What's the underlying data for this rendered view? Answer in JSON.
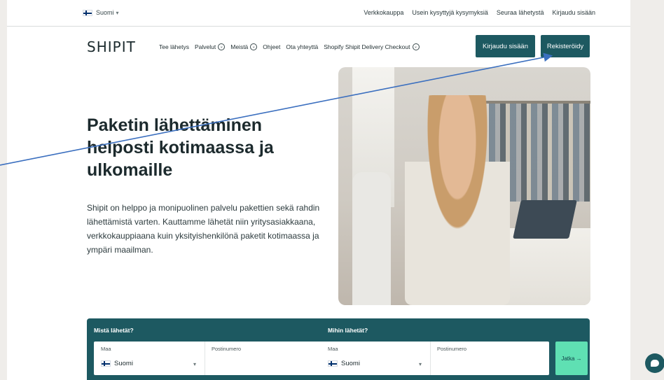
{
  "topbar": {
    "language": "Suomi",
    "links": [
      "Verkkokauppa",
      "Usein kysyttyjä kysymyksiä",
      "Seuraa lähetystä",
      "Kirjaudu sisään"
    ]
  },
  "nav": {
    "logo": "SHIPIT",
    "items": [
      {
        "label": "Tee lähetys",
        "dropdown": false
      },
      {
        "label": "Palvelut",
        "dropdown": true
      },
      {
        "label": "Meistä",
        "dropdown": true
      },
      {
        "label": "Ohjeet",
        "dropdown": false
      },
      {
        "label": "Ota yhteyttä",
        "dropdown": false
      },
      {
        "label": "Shopify Shipit Delivery Checkout",
        "dropdown": true
      }
    ],
    "login_label": "Kirjaudu sisään",
    "register_label": "Rekisteröidy"
  },
  "hero": {
    "title": "Paketin lähettäminen helposti kotimaassa ja ulkomaille",
    "text": "Shipit on helppo ja monipuolinen palvelu pakettien sekä rahdin lähettämistä varten. Kauttamme lähetät niin yritysasiakkaana, verkkokauppiaana kuin yksityishenkilönä paketit kotimaassa ja ympäri maailman."
  },
  "form": {
    "from_label": "Mistä lähetät?",
    "to_label": "Mihin lähetät?",
    "country_label": "Maa",
    "postal_label": "Postinumero",
    "from_country": "Suomi",
    "to_country": "Suomi",
    "continue_label": "Jatka →"
  },
  "colors": {
    "brand": "#1d5961",
    "accent": "#5fe0b3",
    "annotation": "#3b6fbf"
  }
}
